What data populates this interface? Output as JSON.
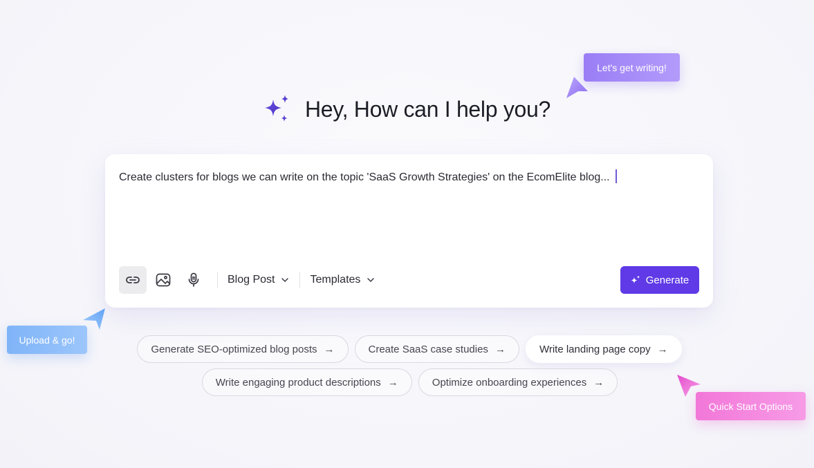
{
  "hero": {
    "title": "Hey, How can I help you?"
  },
  "prompt": {
    "text": "Create clusters for blogs we can write on the topic 'SaaS Growth Strategies' on the EcomElite blog..."
  },
  "toolbar": {
    "content_type": "Blog Post",
    "templates": "Templates",
    "generate_label": "Generate"
  },
  "suggestions_row1": [
    {
      "label": "Generate SEO-optimized blog posts",
      "arrow": "→"
    },
    {
      "label": "Create SaaS case studies",
      "arrow": "→"
    },
    {
      "label": "Write landing page copy",
      "arrow": "→"
    }
  ],
  "suggestions_row2": [
    {
      "label": "Write engaging product descriptions",
      "arrow": "→"
    },
    {
      "label": "Optimize onboarding experiences",
      "arrow": "→"
    }
  ],
  "tags": {
    "writing": "Let's get writing!",
    "upload": "Upload & go!",
    "quick_start": "Quick Start Options"
  },
  "colors": {
    "accent": "#5f3ae6",
    "tag_purple": "#9a7df5",
    "tag_blue": "#7fb4f8",
    "tag_pink": "#f277d8"
  }
}
